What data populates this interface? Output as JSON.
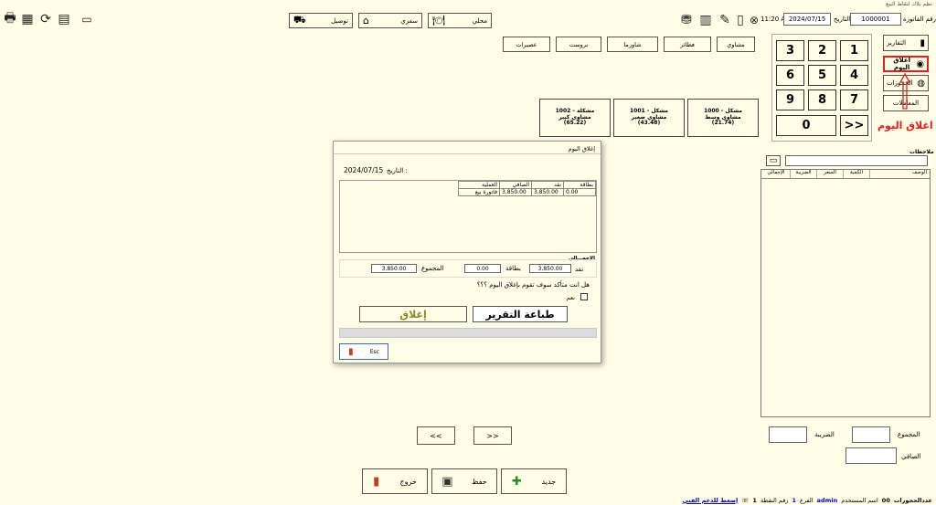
{
  "window": {
    "title": "نظم بلاك لنقاط البيع"
  },
  "header": {
    "invoice_label": "رقم الفاتورة",
    "invoice_value": "1000001",
    "date_label": "التاريخ",
    "date_value": "2024/07/15",
    "time_value": "11:20 AM"
  },
  "order_types": [
    {
      "label": "محلي",
      "icon": "dine-in-icon"
    },
    {
      "label": "سفري",
      "icon": "takeaway-icon"
    },
    {
      "label": "توصيل",
      "icon": "delivery-icon"
    }
  ],
  "side_menu": {
    "reports": "التقارير",
    "close_day": "اغلاق اليوم",
    "reservations": "الحجوزات",
    "transactions": "المعاملات"
  },
  "keypad": {
    "keys": [
      "1",
      "2",
      "3",
      "4",
      "5",
      "6",
      "7",
      "8",
      "9",
      "0",
      ">>"
    ]
  },
  "annotation": {
    "label": "اغلاق اليوم"
  },
  "categories": [
    "مشاوي",
    "فطائر",
    "شاورما",
    "بروست",
    "عصيرات"
  ],
  "products": [
    {
      "name": "1000 - مشكل مشاوي وسط",
      "price": "(21.74)"
    },
    {
      "name": "1001 - مشكل مشاوي صغير",
      "price": "(43.48)"
    },
    {
      "name": "1002 - مشكلة مشاوي كبير",
      "price": "(65.22)"
    }
  ],
  "notes": {
    "label": "ملاحظات"
  },
  "order_table": {
    "headers": [
      "الوصف",
      "الكمية",
      "السعر",
      "الضريبة",
      "الإجمالي"
    ]
  },
  "totals": {
    "sum_label": "المجموع",
    "tax_label": "الضريبة",
    "net_label": "الصافي"
  },
  "pager": {
    "prev": "<<",
    "next": ">>"
  },
  "bottom_buttons": {
    "new": "جديد",
    "save": "حفظ",
    "exit": "خروج"
  },
  "status_bar": {
    "reservations_label": "عددالحجوزات",
    "reservations_value": "00",
    "user_label": "اسم المستخدم",
    "user_value": "admin",
    "branch_label": "الفرع",
    "branch_value": "1",
    "pos_label": "رقم النقطة",
    "pos_value": "1",
    "support_link": "إضغط للدعم الفني"
  },
  "dialog": {
    "title": "إغلاق اليوم",
    "date_label": "التاريخ :",
    "date_value": "2024/07/15",
    "table_headers": [
      "العملية",
      "الصافي",
      "نقد",
      "بطاقة"
    ],
    "rows": [
      {
        "operation": "فاتورة بيع",
        "net": "3,850.00",
        "cash": "3,850.00",
        "card": "0.00"
      }
    ],
    "total_heading": "الإجمـــالي",
    "cash_label": "نقد",
    "cash_value": "3,850.00",
    "card_label": "بطاقة",
    "card_value": "0.00",
    "sum_label": "المجموع",
    "sum_value": "3,850.00",
    "confirm_question": "هل انت متأكد سوف تقوم بإغلاق اليوم ؟؟؟",
    "yes_label": "نعم",
    "print_button": "طباعة التقرير",
    "close_button": "إغلاق",
    "esc_label": "Esc"
  },
  "colors": {
    "background": "#fffde6",
    "annotation_red": "#e02020",
    "link_blue": "#0000cc"
  }
}
